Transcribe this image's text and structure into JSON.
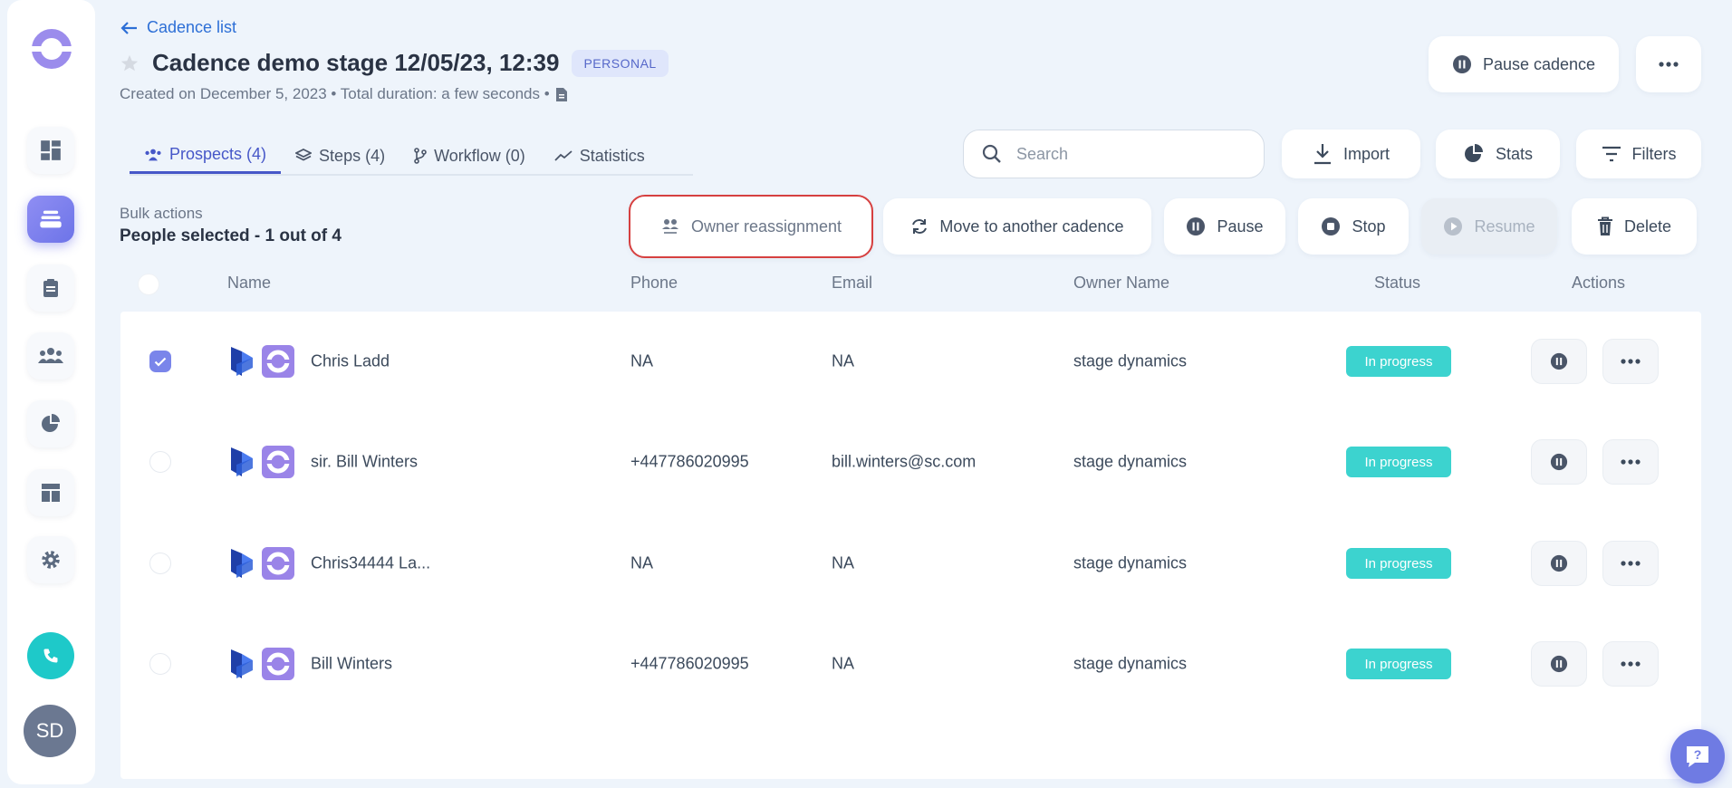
{
  "header": {
    "back_label": "Cadence list",
    "title": "Cadence demo stage 12/05/23, 12:39",
    "badge": "PERSONAL",
    "subtitle": "Created on December 5, 2023 • Total duration: a few seconds •",
    "pause_cadence_label": "Pause cadence"
  },
  "tabs": [
    {
      "label": "Prospects (4)",
      "active": true
    },
    {
      "label": "Steps (4)",
      "active": false
    },
    {
      "label": "Workflow (0)",
      "active": false
    },
    {
      "label": "Statistics",
      "active": false
    }
  ],
  "toolbar": {
    "search_placeholder": "Search",
    "import_label": "Import",
    "stats_label": "Stats",
    "filters_label": "Filters"
  },
  "bulk": {
    "label": "Bulk actions",
    "count": "People selected - 1 out of 4",
    "owner_reassignment": "Owner reassignment",
    "move": "Move to another cadence",
    "pause": "Pause",
    "stop": "Stop",
    "resume": "Resume",
    "delete": "Delete"
  },
  "table": {
    "columns": [
      "Name",
      "Phone",
      "Email",
      "Owner Name",
      "Status",
      "Actions"
    ],
    "rows": [
      {
        "name": "Chris Ladd",
        "phone": "NA",
        "email": "NA",
        "owner": "stage dynamics",
        "status": "In progress",
        "checked": true
      },
      {
        "name": "sir. Bill Winters",
        "phone": "+447786020995",
        "email": "bill.winters@sc.com",
        "owner": "stage dynamics",
        "status": "In progress",
        "checked": false
      },
      {
        "name": "Chris34444 La...",
        "phone": "NA",
        "email": "NA",
        "owner": "stage dynamics",
        "status": "In progress",
        "checked": false
      },
      {
        "name": "Bill Winters",
        "phone": "+447786020995",
        "email": "NA",
        "owner": "stage dynamics",
        "status": "In progress",
        "checked": false
      }
    ]
  },
  "user": {
    "initials": "SD"
  },
  "colors": {
    "accent": "#4657c8",
    "status": "#3cd3cf",
    "logo": "#8c7fe6",
    "phone": "#1ec9c9"
  }
}
